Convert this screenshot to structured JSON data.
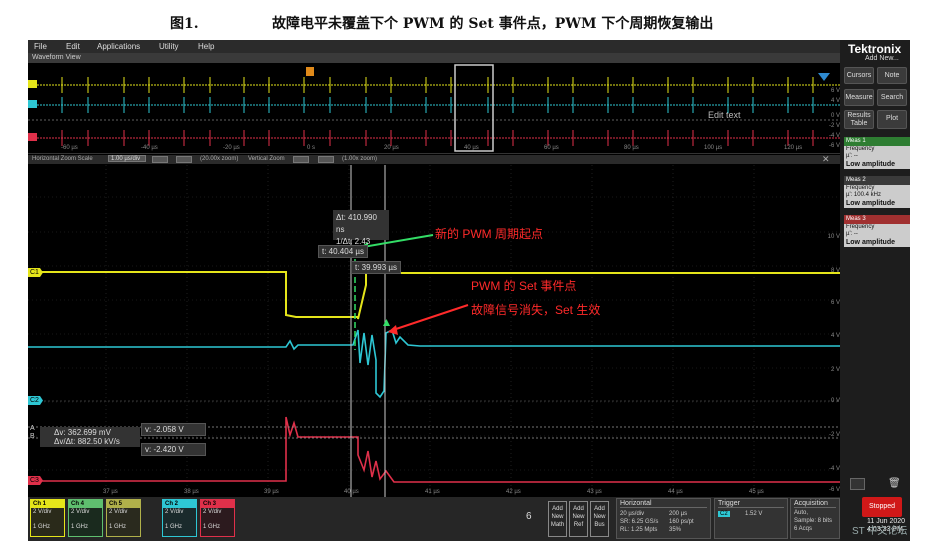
{
  "caption": {
    "figure": "图1.",
    "title": "故障电平未覆盖下个 PWM 的 Set 事件点，PWM 下个周期恢复输出"
  },
  "menu": [
    "File",
    "Edit",
    "Applications",
    "Utility",
    "Help"
  ],
  "waveform_view": {
    "header": "Waveform View",
    "time_labels": [
      "-60 µs",
      "-40 µs",
      "-20 µs",
      "0 s",
      "20 µs",
      "40 µs",
      "60 µs",
      "80 µs",
      "100 µs",
      "120 µs"
    ],
    "edit_text": "Edit text",
    "volt_labels": [
      "6 V",
      "4 V",
      "0 V",
      "-2 V",
      "-4 V",
      "-6 V"
    ]
  },
  "zoom_bar": {
    "horizontal_label": "Horizontal Zoom Scale",
    "horizontal_value": "1.00 µs/div",
    "horizontal_zoom": "(20.00x zoom)",
    "vertical_label": "Vertical Zoom",
    "vertical_zoom": "(1.00x zoom)"
  },
  "cursors": {
    "delta_t": "Δt: 410.990 ns",
    "inv_delta_t": "1/Δt: 2.43 MHz",
    "t1": "t: 40.404 µs",
    "t2": "t: 39.993 µs",
    "delta_v": "Δv: 362.699 mV",
    "delta_v_per_t": "Δv/Δt: 882.50 kV/s",
    "v1": "v: -2.058 V",
    "v2": "v: -2.420 V",
    "tag_a": "A",
    "tag_b": "B"
  },
  "annotations": {
    "new_pwm_start": "新的 PWM 周期起点",
    "set_event": "PWM 的 Set 事件点",
    "fault_disappears": "故障信号消失，Set 生效"
  },
  "main_volt_labels": [
    "10 V",
    "8 V",
    "6 V",
    "4 V",
    "2 V",
    "0 V",
    "-2 V",
    "-4 V",
    "-6 V"
  ],
  "main_time_labels": [
    "37 µs",
    "38 µs",
    "39 µs",
    "40 µs",
    "41 µs",
    "42 µs",
    "43 µs",
    "44 µs",
    "45 µs"
  ],
  "channel_tags": {
    "c1": "C1",
    "c2": "C2",
    "c3": "C3"
  },
  "right_panel": {
    "logo": "Tektronix",
    "add_new": "Add New...",
    "buttons": [
      "Cursors",
      "Note",
      "Measure",
      "Search",
      "Results Table",
      "Plot"
    ],
    "measurements": [
      {
        "header": "Meas 1",
        "name": "Frequency",
        "mu": "µ': --",
        "value": "Low amplitude",
        "color": "#2e7d32"
      },
      {
        "header": "Meas 2",
        "name": "Frequency",
        "mu": "µ': 100.4 kHz",
        "value": "Low amplitude",
        "color": "#3a3a3a"
      },
      {
        "header": "Meas 3",
        "name": "Frequency",
        "mu": "µ': --",
        "value": "Low amplitude",
        "color": "#a03030"
      }
    ],
    "stopped": "Stopped",
    "date": "11 Jun 2020",
    "time": "4:03:33 PM"
  },
  "channels": [
    {
      "name": "Ch 1",
      "scale": "2 V/div",
      "bw": "1 GHz",
      "color": "#e5e51a"
    },
    {
      "name": "Ch 4",
      "scale": "2 V/div",
      "bw": "1 GHz",
      "color": "#5fbf6f"
    },
    {
      "name": "Ch 5",
      "scale": "2 V/div",
      "bw": "1 GHz",
      "color": "#b0b04a"
    },
    {
      "name": "Ch 2",
      "scale": "2 V/div",
      "bw": "1 GHz",
      "color": "#2ec7d4"
    },
    {
      "name": "Ch 3",
      "scale": "2 V/div",
      "bw": "1 GHz",
      "color": "#e0304a"
    }
  ],
  "bottom": {
    "count": "6",
    "add_math": "Add New Math",
    "add_ref": "Add New Ref",
    "add_bus": "Add New Bus",
    "horizontal": {
      "title": "Horizontal",
      "l1": "20 µs/div",
      "l2": "SR: 6.25 GS/s",
      "l3": "RL: 1.25 Mpts",
      "r1": "200 µs",
      "r2": "160 ps/pt",
      "r3": "35%"
    },
    "trigger": {
      "title": "Trigger",
      "level": "1.52 V"
    },
    "acquisition": {
      "title": "Acquisition",
      "l1": "Auto,",
      "l2": "Sample: 8 bits",
      "l3": "6 Acqs",
      "r1": "Analyze"
    }
  },
  "watermark": "ST 中文论坛"
}
